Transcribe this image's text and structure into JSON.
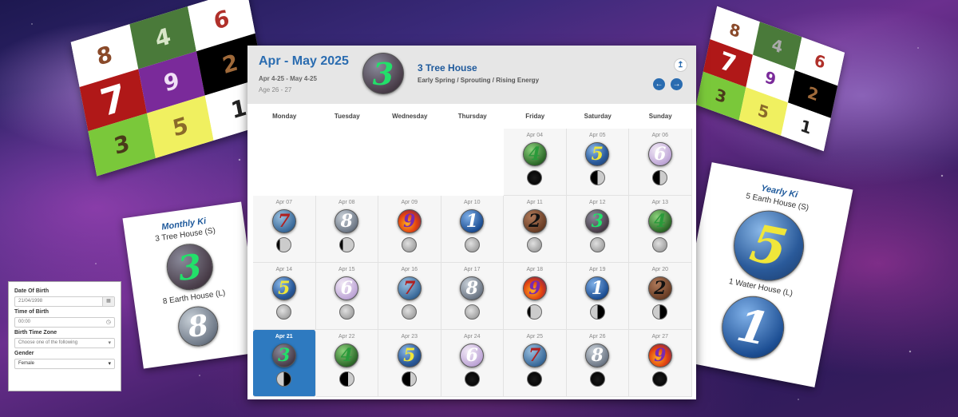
{
  "theme_colors": {
    "accent": "#2a6cb0",
    "today": "#2e7ac0",
    "title": "#1f5a9c"
  },
  "magic_square_left": {
    "cells": [
      {
        "n": "8",
        "bg": "#ffffff",
        "fg": "#8a4a2a"
      },
      {
        "n": "4",
        "bg": "#4a7a3a",
        "fg": "#d8e6c8"
      },
      {
        "n": "6",
        "bg": "#ffffff",
        "fg": "#b0302a"
      },
      {
        "n": "7",
        "bg": "#b01818",
        "fg": "#ffffff",
        "big": true
      },
      {
        "n": "9",
        "bg": "#7a2a9a",
        "fg": "#f0e0f6"
      },
      {
        "n": "2",
        "bg": "#000000",
        "fg": "#a06a3a"
      },
      {
        "n": "3",
        "bg": "#7ac83a",
        "fg": "#4a3a1a"
      },
      {
        "n": "5",
        "bg": "#f0f060",
        "fg": "#8a6a2a"
      },
      {
        "n": "1",
        "bg": "#ffffff",
        "fg": "#222222"
      }
    ]
  },
  "magic_square_right": {
    "cells": [
      {
        "n": "8",
        "bg": "#ffffff",
        "fg": "#8a4a2a"
      },
      {
        "n": "4",
        "bg": "#4a7a3a",
        "fg": "#aaa"
      },
      {
        "n": "6",
        "bg": "#ffffff",
        "fg": "#b0302a"
      },
      {
        "n": "7",
        "bg": "#b01818",
        "fg": "#ffffff",
        "big": true
      },
      {
        "n": "9",
        "bg": "#ffffff",
        "fg": "#7a2a9a"
      },
      {
        "n": "2",
        "bg": "#000000",
        "fg": "#a06a3a"
      },
      {
        "n": "3",
        "bg": "#7ac83a",
        "fg": "#4a3a1a"
      },
      {
        "n": "5",
        "bg": "#f0f060",
        "fg": "#8a6a2a"
      },
      {
        "n": "1",
        "bg": "#ffffff",
        "fg": "#222222"
      }
    ]
  },
  "monthly_ki": {
    "title": "Monthly Ki",
    "primary": "3 Tree House (S)",
    "primary_number": "3",
    "secondary": "8 Earth House (L)",
    "secondary_number": "8"
  },
  "yearly_ki": {
    "title": "Yearly Ki",
    "primary": "5 Earth House (S)",
    "primary_number": "5",
    "secondary": "1 Water House (L)",
    "secondary_number": "1"
  },
  "form": {
    "dob_label": "Date Of Birth",
    "dob_value": "21/04/1998",
    "dob_icon": "calendar-icon",
    "tob_label": "Time of Birth",
    "tob_value": "00:00",
    "tob_icon": "clock-icon",
    "tz_label": "Birth Time Zone",
    "tz_placeholder": "Choose one of the following",
    "gender_label": "Gender",
    "gender_value": "Female"
  },
  "calendar": {
    "range": "Apr - May 2025",
    "dates": "Apr 4-25 - May 4-25",
    "age": "Age 26 - 27",
    "house_number": "3",
    "house": "3 Tree House",
    "description": "Early Spring / Sprouting / Rising Energy",
    "weekdays": [
      "Monday",
      "Tuesday",
      "Wednesday",
      "Thursday",
      "Friday",
      "Saturday",
      "Sunday"
    ],
    "days": [
      {
        "label": "",
        "num": ""
      },
      {
        "label": "",
        "num": ""
      },
      {
        "label": "",
        "num": ""
      },
      {
        "label": "",
        "num": ""
      },
      {
        "label": "Apr 04",
        "num": "4",
        "moon": "new"
      },
      {
        "label": "Apr 05",
        "num": "5",
        "moon": "first"
      },
      {
        "label": "Apr 06",
        "num": "6",
        "moon": "first"
      },
      {
        "label": "Apr 07",
        "num": "7",
        "moon": "gibbous"
      },
      {
        "label": "Apr 08",
        "num": "8",
        "moon": "gibbous"
      },
      {
        "label": "Apr 09",
        "num": "9",
        "moon": "full"
      },
      {
        "label": "Apr 10",
        "num": "1",
        "moon": "full"
      },
      {
        "label": "Apr 11",
        "num": "2",
        "moon": "full"
      },
      {
        "label": "Apr 12",
        "num": "3",
        "moon": "full"
      },
      {
        "label": "Apr 13",
        "num": "4",
        "moon": "full"
      },
      {
        "label": "Apr 14",
        "num": "5",
        "moon": "full"
      },
      {
        "label": "Apr 15",
        "num": "6",
        "moon": "full"
      },
      {
        "label": "Apr 16",
        "num": "7",
        "moon": "full"
      },
      {
        "label": "Apr 17",
        "num": "8",
        "moon": "full"
      },
      {
        "label": "Apr 18",
        "num": "9",
        "moon": "gibbous"
      },
      {
        "label": "Apr 19",
        "num": "1",
        "moon": "last"
      },
      {
        "label": "Apr 20",
        "num": "2",
        "moon": "last"
      },
      {
        "label": "Apr 21",
        "num": "3",
        "moon": "last",
        "today": true
      },
      {
        "label": "Apr 22",
        "num": "4",
        "moon": "crescent"
      },
      {
        "label": "Apr 23",
        "num": "5",
        "moon": "crescent"
      },
      {
        "label": "Apr 24",
        "num": "6",
        "moon": "new"
      },
      {
        "label": "Apr 25",
        "num": "7",
        "moon": "new"
      },
      {
        "label": "Apr 26",
        "num": "8",
        "moon": "new"
      },
      {
        "label": "Apr 27",
        "num": "9",
        "moon": "new"
      }
    ]
  },
  "orb_styles": {
    "1": {
      "bg": "radial-gradient(circle at 35% 30%,#7fb0e8,#1d4f94 70%,#0c2a5a)",
      "fg": "#ffffff"
    },
    "2": {
      "bg": "radial-gradient(circle at 35% 30%,#b07a5a,#6a3e26 70%,#3a2010)",
      "fg": "#111111"
    },
    "3": {
      "bg": "radial-gradient(circle at 35% 30%,#8a8a9a,#4a3e4a 70%,#2a222a)",
      "fg": "#22e06a"
    },
    "4": {
      "bg": "radial-gradient(circle at 35% 30%,#8ad07a,#2e6a2a 70%,#163a14)",
      "fg": "#2a9a3a"
    },
    "5": {
      "bg": "radial-gradient(circle at 35% 30%,#8ab8e8,#2a5a9a 60%,#1a3a6a)",
      "fg": "#f0e63a"
    },
    "6": {
      "bg": "radial-gradient(circle at 35% 30%,#f2eaf6,#c0a8d8 70%,#8a70a8)",
      "fg": "#ffffff"
    },
    "7": {
      "bg": "radial-gradient(circle at 35% 30%,#9ac0e0,#3a6a9a 70%,#1a3a5a)",
      "fg": "#b02020"
    },
    "8": {
      "bg": "radial-gradient(circle at 35% 30%,#c8d0d8,#707a88 70%,#3a4250)",
      "fg": "#ffffff"
    },
    "9": {
      "bg": "radial-gradient(circle at 40% 60%,#ffb020,#e04010 50%,#5a1a6a)",
      "fg": "#7a2ab0"
    }
  },
  "moon_styles": {
    "new": "radial-gradient(circle,#1a1a1a,#000)",
    "crescent": "linear-gradient(90deg,#000 60%,#ccc 60%)",
    "first": "linear-gradient(90deg,#000 50%,#ccc 50%)",
    "gibbous": "linear-gradient(90deg,#000 20%,#ccc 20%)",
    "full": "radial-gradient(circle at 40% 40%,#e0e0e0,#8a8a8a)",
    "last": "linear-gradient(90deg,#ccc 50%,#000 50%)"
  }
}
